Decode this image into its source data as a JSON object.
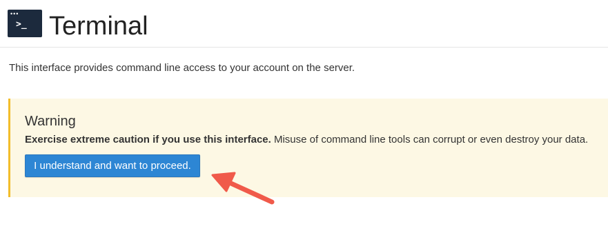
{
  "header": {
    "icon": "terminal-icon",
    "icon_prompt": ">_",
    "title": "Terminal"
  },
  "description": "This interface provides command line access to your account on the server.",
  "warning": {
    "title": "Warning",
    "bold_text": "Exercise extreme caution if you use this interface.",
    "text": " Misuse of command line tools can corrupt or even destroy your data.",
    "button_label": "I understand and want to proceed."
  },
  "annotation": {
    "icon": "arrow-icon",
    "color": "#f05a4a"
  },
  "colors": {
    "warning_background": "#fdf8e4",
    "warning_border": "#f2bd2b",
    "button_background": "#2d86d4",
    "icon_background": "#1c2a3d"
  }
}
